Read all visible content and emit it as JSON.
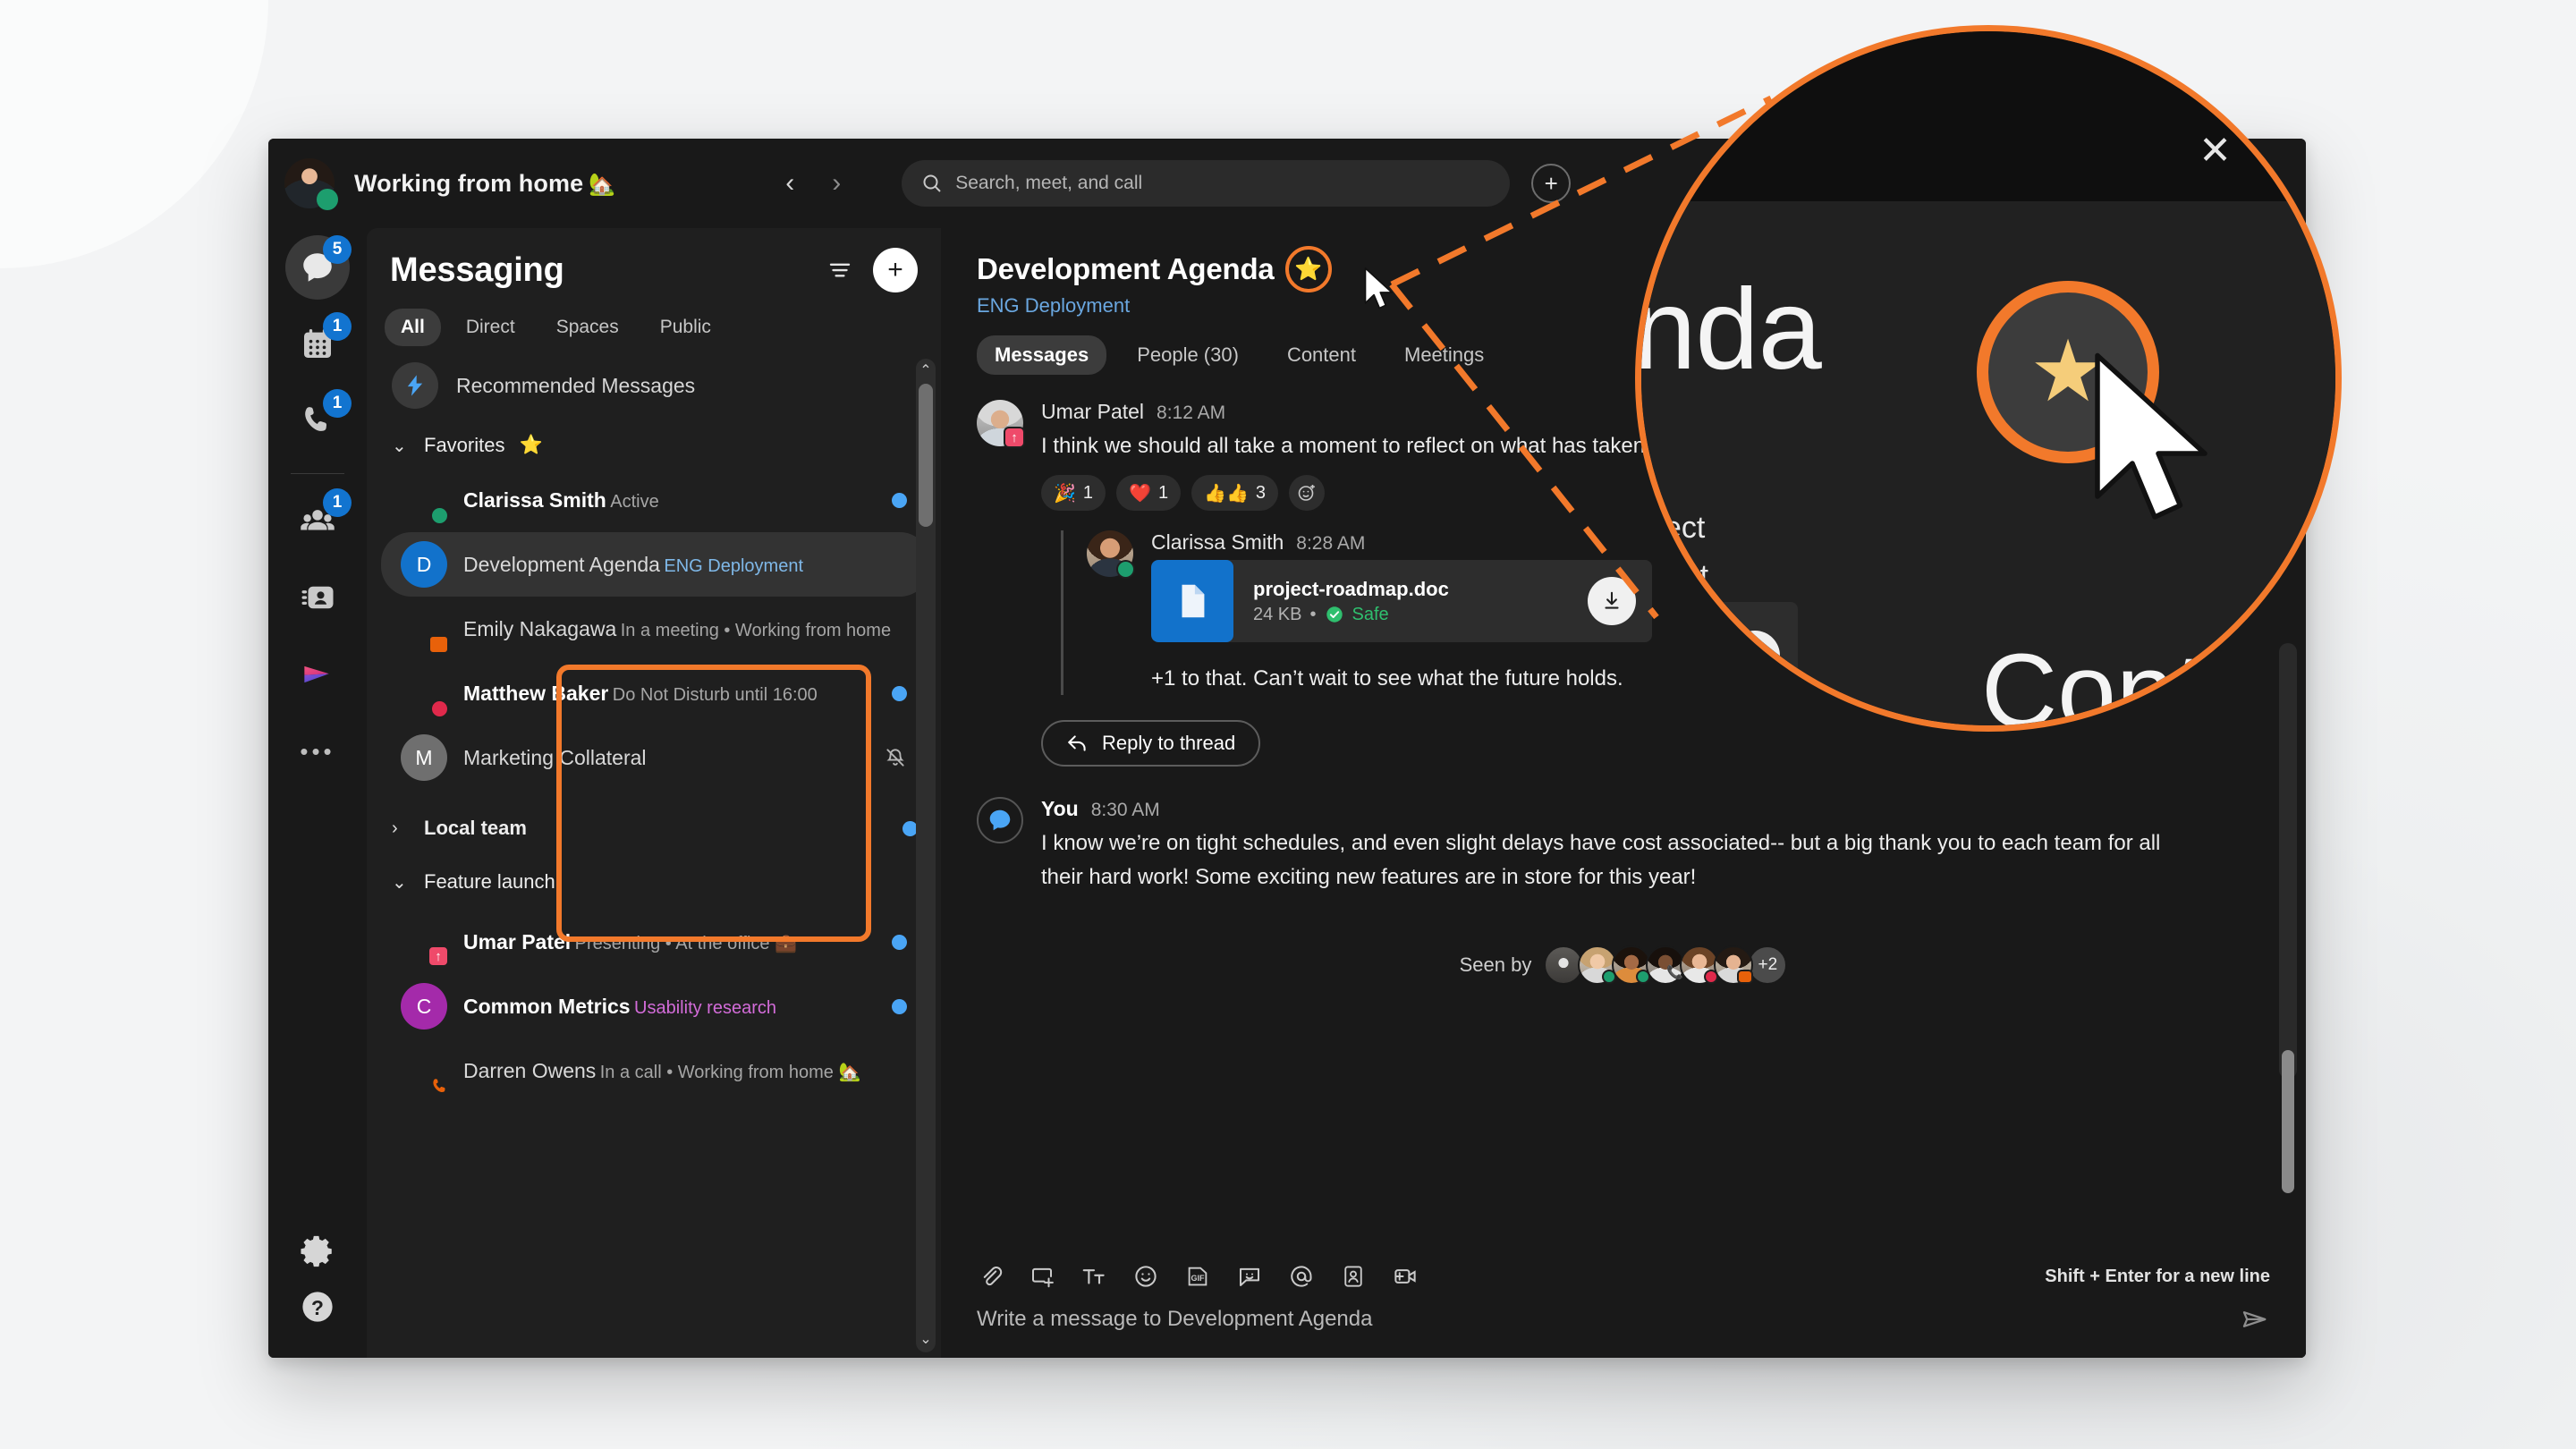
{
  "window": {
    "topbar": {
      "user_status": "Working from home",
      "user_status_emoji": "🏡",
      "back_label": "‹",
      "forward_label": "›",
      "search_placeholder": "Search, meet, and call",
      "plus_label": "+",
      "close_label": "✕"
    },
    "rail": {
      "items": [
        {
          "name": "messaging",
          "icon": "chat-bubble-icon",
          "badge": "5",
          "active": true
        },
        {
          "name": "meetings",
          "icon": "calendar-icon",
          "badge": "1",
          "active": false
        },
        {
          "name": "calling",
          "icon": "phone-icon",
          "badge": "1",
          "active": false
        },
        {
          "name": "teams",
          "icon": "people-icon",
          "badge": "1",
          "active": false
        },
        {
          "name": "contacts",
          "icon": "contact-card-icon",
          "badge": "",
          "active": false
        },
        {
          "name": "apps",
          "icon": "webex-apps-icon",
          "badge": "",
          "active": false
        },
        {
          "name": "more",
          "icon": "more-dots-icon",
          "badge": "",
          "active": false
        }
      ],
      "bottom": [
        {
          "name": "settings",
          "icon": "gear-icon"
        },
        {
          "name": "help",
          "icon": "question-mark-icon"
        }
      ]
    },
    "list_panel": {
      "title": "Messaging",
      "filter_icon": "filter-icon",
      "compose_label": "+",
      "tabs": [
        {
          "label": "All",
          "active": true
        },
        {
          "label": "Direct",
          "active": false
        },
        {
          "label": "Spaces",
          "active": false
        },
        {
          "label": "Public",
          "active": false
        }
      ],
      "recommended_label": "Recommended Messages",
      "groups": [
        {
          "name": "Favorites",
          "expanded": true,
          "star": "⭐",
          "bold": false,
          "unread_dot": false,
          "highlighted": true,
          "items": [
            {
              "name": "Clarissa Smith",
              "sub": "Active",
              "sub_color": "default",
              "avatar": "photo-woman-1",
              "mono": "",
              "mono_bg": "",
              "presence": "active",
              "unread": true,
              "muted": false,
              "selected": false,
              "bold": true
            },
            {
              "name": "Development Agenda",
              "sub": "ENG Deployment",
              "sub_color": "blue",
              "avatar": "mono",
              "mono": "D",
              "mono_bg": "#1272cb",
              "presence": "",
              "unread": false,
              "muted": false,
              "selected": true,
              "bold": false
            },
            {
              "name": "Emily Nakagawa",
              "sub": "In a meeting  •  Working from home",
              "sub_color": "default",
              "avatar": "photo-woman-2",
              "mono": "",
              "mono_bg": "",
              "presence": "meeting",
              "unread": false,
              "muted": false,
              "selected": false,
              "bold": false
            },
            {
              "name": "Matthew Baker",
              "sub": "Do Not Disturb until 16:00",
              "sub_color": "default",
              "avatar": "photo-man-1",
              "mono": "",
              "mono_bg": "",
              "presence": "dnd",
              "unread": true,
              "muted": false,
              "selected": false,
              "bold": true
            },
            {
              "name": "Marketing Collateral",
              "sub": "",
              "sub_color": "default",
              "avatar": "mono",
              "mono": "M",
              "mono_bg": "#6f6f6f",
              "presence": "",
              "unread": false,
              "muted": true,
              "selected": false,
              "bold": false
            }
          ]
        },
        {
          "name": "Local team",
          "expanded": false,
          "star": "",
          "bold": true,
          "unread_dot": true,
          "highlighted": false,
          "items": []
        },
        {
          "name": "Feature launch",
          "expanded": true,
          "star": "",
          "bold": false,
          "unread_dot": false,
          "highlighted": false,
          "items": [
            {
              "name": "Umar Patel",
              "sub": "Presenting  •  At the office 💼",
              "sub_color": "default",
              "avatar": "photo-man-2",
              "mono": "",
              "mono_bg": "",
              "presence": "presenting",
              "unread": true,
              "muted": false,
              "selected": false,
              "bold": true
            },
            {
              "name": "Common Metrics",
              "sub": "Usability research",
              "sub_color": "purple",
              "avatar": "mono",
              "mono": "C",
              "mono_bg": "#a42aaa",
              "presence": "",
              "unread": true,
              "muted": false,
              "selected": false,
              "bold": true
            },
            {
              "name": "Darren Owens",
              "sub": "In a call  •  Working from home 🏡",
              "sub_color": "default",
              "avatar": "photo-man-3",
              "mono": "",
              "mono_bg": "",
              "presence": "call",
              "unread": false,
              "muted": false,
              "selected": false,
              "bold": false
            }
          ]
        }
      ]
    },
    "chat": {
      "title": "Development Agenda",
      "favorite_star": "⭐",
      "subtitle": "ENG Deployment",
      "tabs": [
        {
          "label": "Messages",
          "active": true
        },
        {
          "label": "People (30)",
          "active": false
        },
        {
          "label": "Content",
          "active": false
        },
        {
          "label": "Meetings",
          "active": false
        }
      ],
      "messages": [
        {
          "author": "Umar Patel",
          "time": "8:12 AM",
          "text": "I think we should all take a moment to reflect on what has taken us through the last quarter alone. Great",
          "reactions": [
            {
              "emoji": "🎉",
              "count": "1"
            },
            {
              "emoji": "❤️",
              "count": "1"
            },
            {
              "emoji": "👍👍",
              "count": "3"
            }
          ],
          "add_reaction_icon": "add-reaction-icon"
        },
        {
          "author": "Clarissa Smith",
          "time": "8:28 AM",
          "text": "+1 to that. Can’t wait to see what the future holds.",
          "is_thread": true,
          "file": {
            "name": "project-roadmap.doc",
            "size": "24 KB",
            "status": "Safe",
            "download_icon": "download-icon"
          }
        }
      ],
      "reply_button": "Reply to thread",
      "own_message": {
        "author": "You",
        "time": "8:30 AM",
        "text": "I know we’re on tight schedules, and even slight delays have cost associated-- but a big thank you to each team for all their hard work! Some exciting new features are in store for this year!"
      },
      "seen_by_label": "Seen by",
      "seen_by_overflow": "+2"
    },
    "composer": {
      "tools": [
        "attachment-icon",
        "screen-capture-icon",
        "text-format-icon",
        "emoji-icon",
        "gif-icon",
        "sticker-icon",
        "mention-icon",
        "contact-card-icon",
        "video-message-icon"
      ],
      "hint": "Shift + Enter for a new line",
      "placeholder": "Write a message to Development Agenda",
      "send_icon": "send-icon"
    },
    "magnifier": {
      "word_fragment": "enda",
      "tab_fragment": "Cont",
      "star": "⭐",
      "close_label": "✕",
      "plus_label": "+",
      "left_text_1": "eflect",
      "left_text_2": "Great"
    },
    "colors": {
      "accent_orange": "#f2792b",
      "badge_blue": "#1274d0",
      "unread_blue": "#4aa5f5",
      "link_blue": "#6aa7e0",
      "presence_active": "#1d9e6e",
      "presence_dnd": "#e0294b",
      "presence_meeting": "#e8610a",
      "safe_green": "#2fbf6e",
      "purple": "#d36cd9",
      "window_bg": "#191919",
      "list_bg": "#1f1f1f"
    }
  }
}
